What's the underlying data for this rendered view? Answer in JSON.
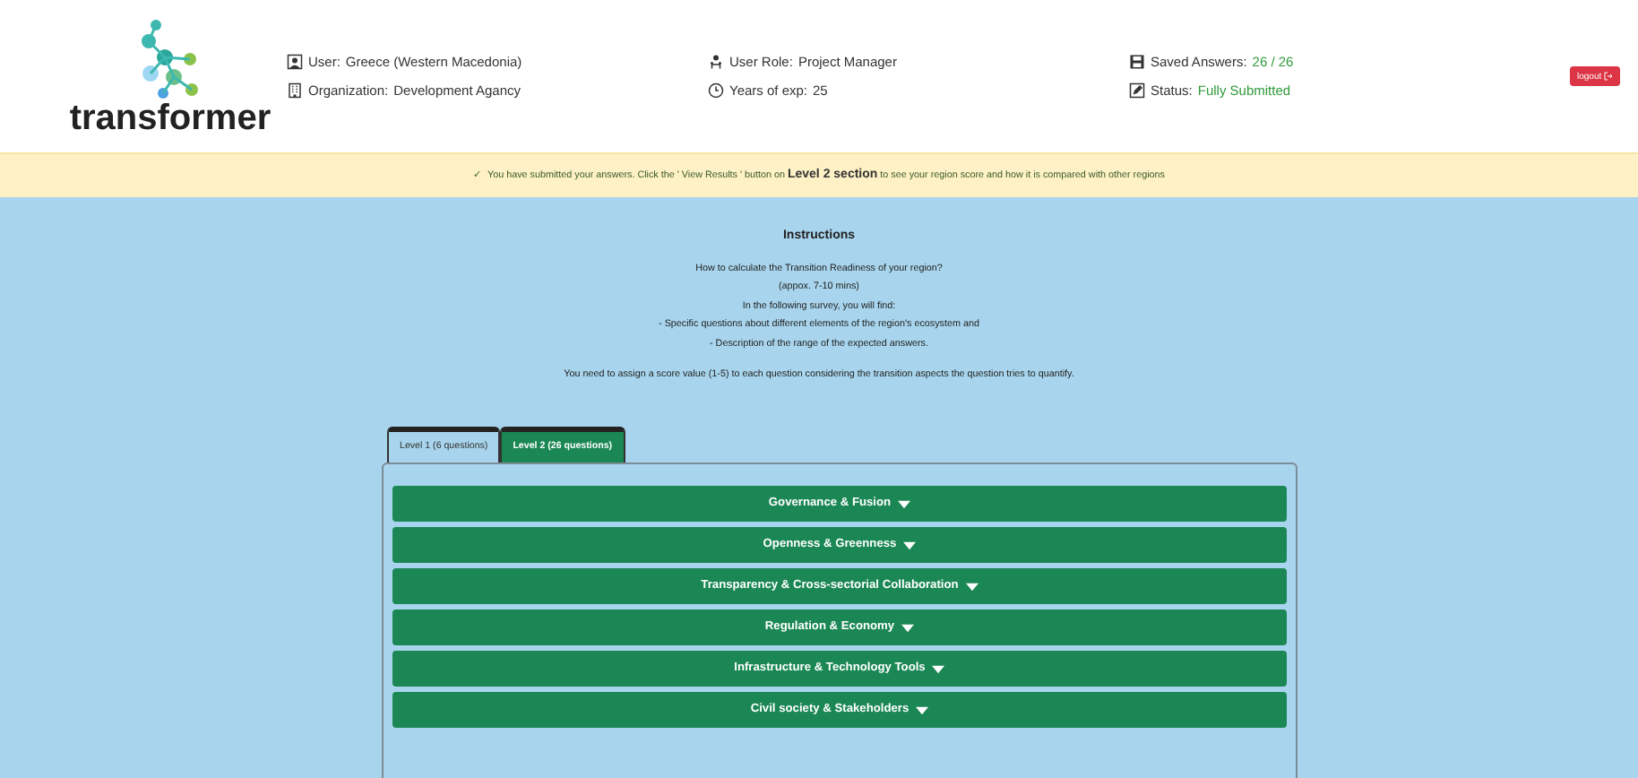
{
  "logo": {
    "text": "transformer"
  },
  "info_columns": [
    [
      {
        "label": "User:",
        "value": "Greece (Western Macedonia)",
        "highlighted": false
      },
      {
        "label": "Organization:",
        "value": "Development Agancy",
        "highlighted": false
      }
    ],
    [
      {
        "label": "User Role:",
        "value": "Project Manager",
        "highlighted": false
      },
      {
        "label": "Years of exp:",
        "value": "25",
        "highlighted": false
      }
    ],
    [
      {
        "label": "Saved Answers:",
        "value": "26 / 26",
        "highlighted": true
      },
      {
        "label": "Status:",
        "value": "Fully Submitted",
        "highlighted": true
      }
    ]
  ],
  "logout_button": {
    "label": "logout"
  },
  "notice": {
    "icon": "✓",
    "text": "You have submitted your answers. Click the ' View Results ' button on **Level 2 section** to see your region score and how it is compared with other regions"
  },
  "instructions": {
    "title": "Instructions",
    "lines": [
      "How to calculate the Transition Readiness of your region?",
      "(appox. 7-10 mins)",
      "In the following survey, you will find:",
      "- Specific questions about different elements of the region's ecosystem and",
      "- Description of the range of the expected answers."
    ],
    "note": "You need to assign a score value (1-5) to each question considering the transition aspects the question tries to quantify."
  },
  "tabs": [
    {
      "label": "Level 1 (6 questions)",
      "selected": false
    },
    {
      "label": "Level 2 (26 questions)",
      "selected": true
    }
  ],
  "sections": [
    {
      "label": "Governance & Fusion",
      "expanded": false
    },
    {
      "label": "Openness & Greenness",
      "expanded": false
    },
    {
      "label": "Transparency & Cross-sectorial Collaboration",
      "expanded": false
    },
    {
      "label": "Regulation & Economy",
      "expanded": false
    },
    {
      "label": "Infrastructure & Technology Tools",
      "expanded": false
    },
    {
      "label": "Civil society & Stakeholders",
      "expanded": false
    }
  ]
}
